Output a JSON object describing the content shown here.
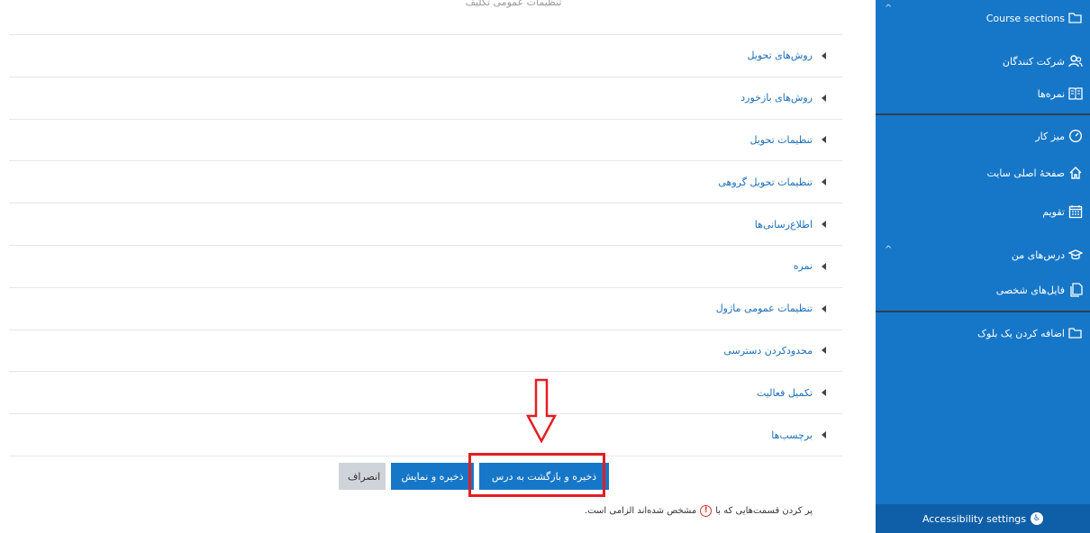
{
  "top_partial_text": "تنظیمات عمومی تکلیف",
  "sections": [
    {
      "label": "روش‌های تحویل"
    },
    {
      "label": "روش‌های بازخورد"
    },
    {
      "label": "تنظیمات تحویل"
    },
    {
      "label": "تنظیمات تحویل گروهی"
    },
    {
      "label": "اطلاع‌رسانی‌ها"
    },
    {
      "label": "نمره"
    },
    {
      "label": "تنظیمات عمومی ماژول"
    },
    {
      "label": "محدودکردن دسترسی"
    },
    {
      "label": "تکمیل فعالیت"
    },
    {
      "label": "برچسب‌ها"
    }
  ],
  "buttons": {
    "save_return": "ذخیره و بازگشت به درس",
    "save_display": "ذخیره و نمایش",
    "cancel": "انصراف"
  },
  "required_note": {
    "before": "پر کردن قسمت‌هایی که با",
    "after": "مشخص شده‌اند الزامی است."
  },
  "sidebar": {
    "course_sections": "Course sections",
    "participants": "شرکت کنندگان",
    "grades": "نمره‌ها",
    "dashboard": "میز کار",
    "site_home": "صفحهٔ اصلی سایت",
    "calendar": "تقویم",
    "my_courses": "درس‌های من",
    "private_files": "فایل‌های شخصی",
    "add_block": "اضافه کردن یک بلوک",
    "accessibility": "Accessibility settings"
  },
  "colors": {
    "brand": "#1677c8",
    "link": "#1d6fb8",
    "highlight": "#e31e24"
  }
}
